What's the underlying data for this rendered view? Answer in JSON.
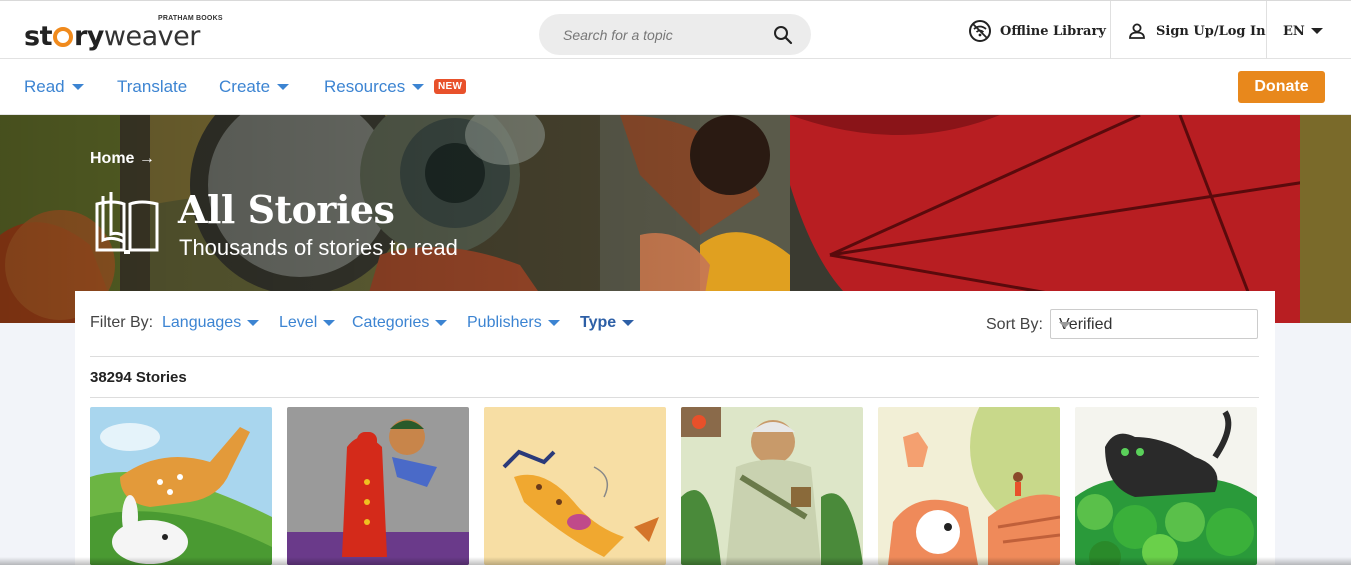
{
  "header": {
    "logo": {
      "story": "st",
      "ry": "ry",
      "weaver": "weaver",
      "publisher": "PRATHAM BOOKS"
    },
    "search": {
      "placeholder": "Search for a topic"
    },
    "offline_label": "Offline Library",
    "signin_label": "Sign Up/Log In",
    "language": "EN"
  },
  "nav": {
    "items": [
      {
        "label": "Read",
        "dropdown": true
      },
      {
        "label": "Translate",
        "dropdown": false
      },
      {
        "label": "Create",
        "dropdown": true
      },
      {
        "label": "Resources",
        "dropdown": true
      }
    ],
    "new_badge": "NEW",
    "donate_label": "Donate"
  },
  "hero": {
    "breadcrumb": "Home →",
    "title": "All Stories",
    "subtitle": "Thousands of stories to read"
  },
  "filters": {
    "label": "Filter By:",
    "items": [
      "Languages",
      "Level",
      "Categories",
      "Publishers",
      "Type"
    ],
    "sort_label": "Sort By:",
    "sort_value": "Verified"
  },
  "results": {
    "count_text": "38294 Stories"
  },
  "colors": {
    "link_blue": "#3c84d2",
    "donate_orange": "#e8881c",
    "badge_red": "#e8512b"
  },
  "icons": {
    "search": "search-icon",
    "offline": "wifi-off-icon",
    "user": "user-icon",
    "book": "open-book-icon"
  }
}
